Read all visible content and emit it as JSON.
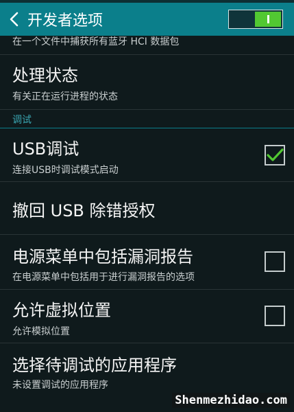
{
  "header": {
    "title": "开发者选项",
    "switch_on": true
  },
  "rows": {
    "hci_snoop": {
      "subtitle": "在一个文件中捕获所有蓝牙 HCI 数据包"
    },
    "process_stats": {
      "title": "处理状态",
      "subtitle": "有关正在运行进程的状态"
    },
    "section_debug": "调试",
    "usb_debugging": {
      "title": "USB调试",
      "subtitle": "连接USB时调试模式启动",
      "checked": true
    },
    "revoke_usb": {
      "title": "撤回 USB 除错授权"
    },
    "bug_report": {
      "title": "电源菜单中包括漏洞报告",
      "subtitle": "在电源菜单中包括用于进行漏洞报告的选项",
      "checked": false
    },
    "mock_location": {
      "title": "允许虚拟位置",
      "subtitle": "允许模拟位置",
      "checked": false
    },
    "debug_app": {
      "title": "选择待调试的应用程序",
      "subtitle": "未设置调试的应用程序"
    }
  },
  "watermark": "Shenmezhidao.com",
  "colors": {
    "actionbar": "#0b7f8b",
    "background": "#0f1a1c",
    "accent_green": "#52c832",
    "section_header": "#3aa7b3"
  },
  "icons": {
    "back": "chevron-left-icon",
    "check": "checkmark-icon"
  }
}
